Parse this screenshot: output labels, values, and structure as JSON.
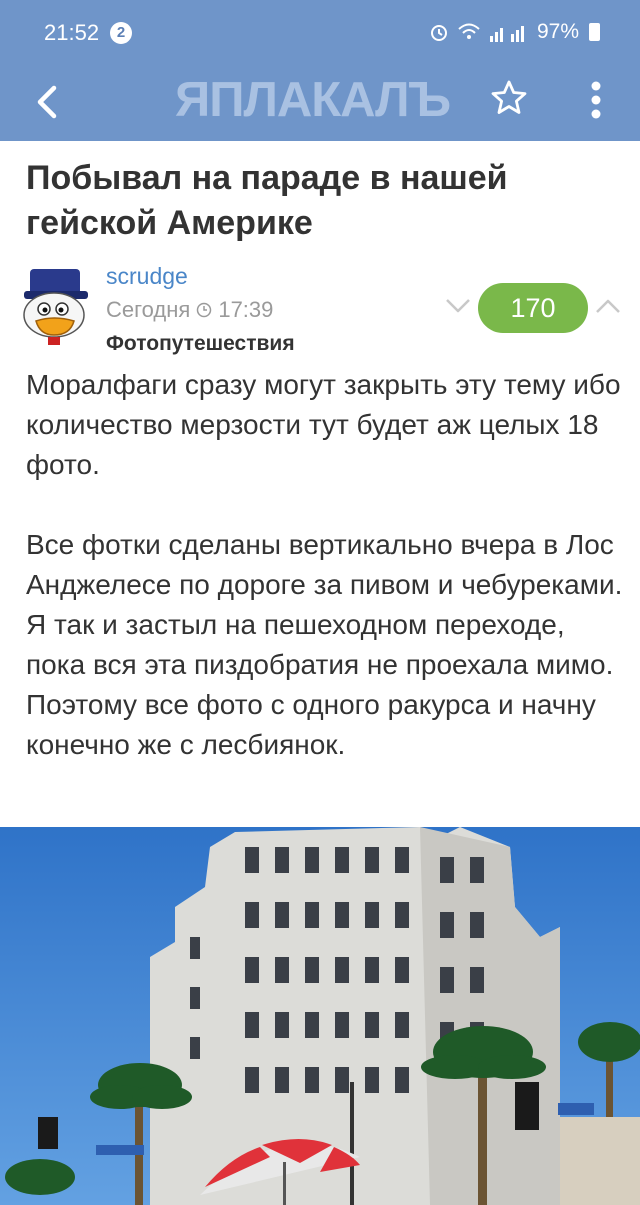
{
  "status_bar": {
    "time": "21:52",
    "notification_count": "2",
    "battery": "97%"
  },
  "app_bar": {
    "logo_text": "ЯПЛАКАЛЪ"
  },
  "post": {
    "title": "Побывал на параде в нашей гейской Америке",
    "author": "scrudge",
    "date_label": "Сегодня",
    "time": "17:39",
    "category": "Фотопутешествия",
    "rating": "170",
    "paragraphs": [
      "Моралфаги сразу могут закрыть эту тему ибо количество мерзости тут будет аж целых 18 фото.",
      "Все фотки сделаны вертикально вчера в Лос Анджелесе по дороге за пивом и чебуреками. Я так и застыл на пешеходном переходе, пока вся эта пиздобратия не проехала мимо. Поэтому все фото с одного ракурса и начну конечно же с лесбиянок."
    ]
  },
  "colors": {
    "header": "#6f95c9",
    "rating_bg": "#7ab84a",
    "author": "#4a86c8"
  },
  "icons": [
    "back-icon",
    "star-icon",
    "more-vert-icon",
    "clock-icon",
    "chevron-down-icon",
    "chevron-up-icon"
  ]
}
